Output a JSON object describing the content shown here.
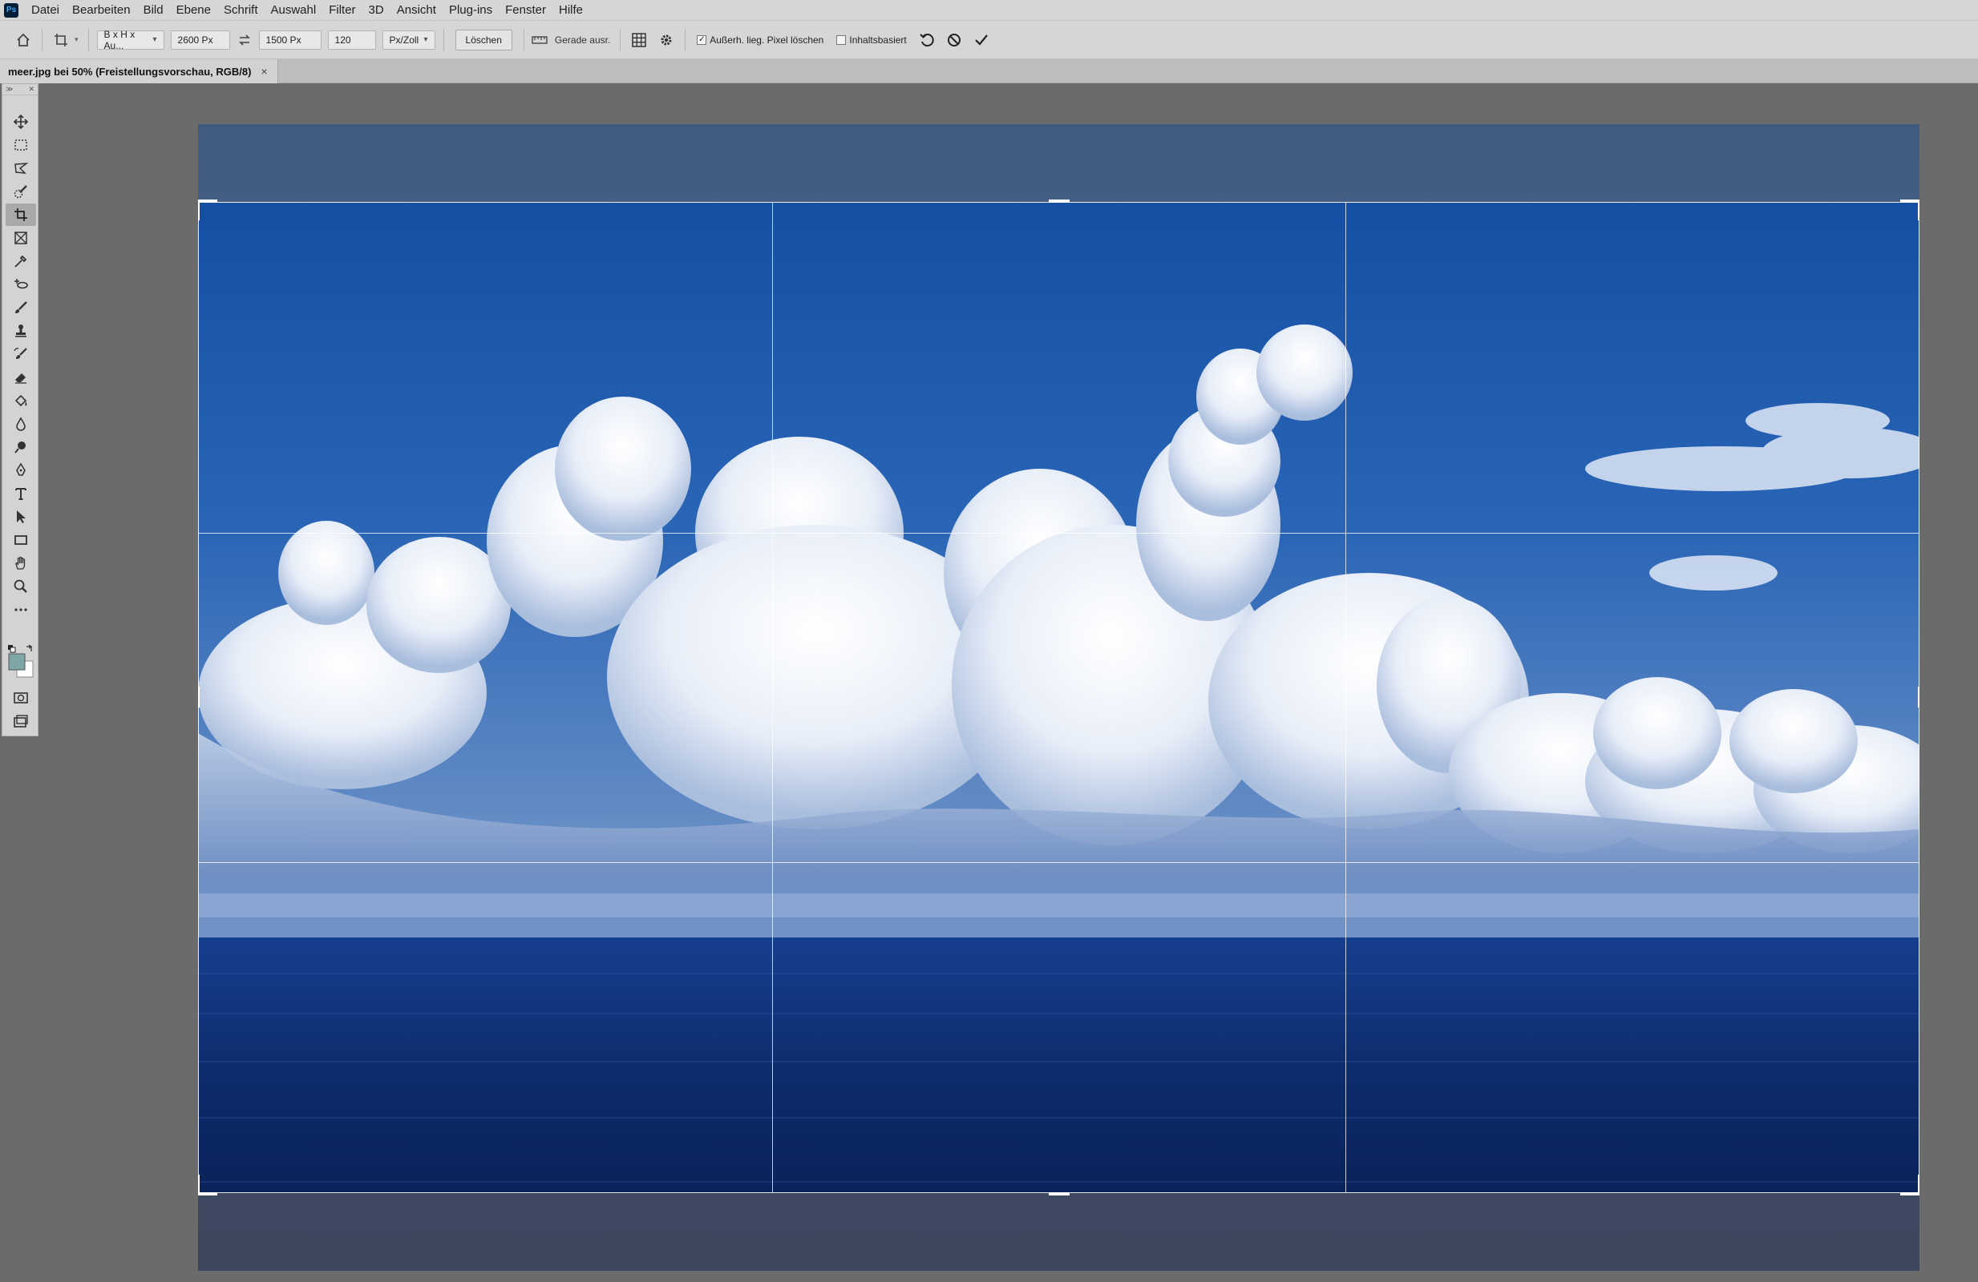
{
  "app": {
    "logo_text": "Ps"
  },
  "menu": [
    "Datei",
    "Bearbeiten",
    "Bild",
    "Ebene",
    "Schrift",
    "Auswahl",
    "Filter",
    "3D",
    "Ansicht",
    "Plug-ins",
    "Fenster",
    "Hilfe"
  ],
  "options": {
    "ratio_preset": "B x H x Au...",
    "width": "2600 Px",
    "height": "1500 Px",
    "resolution": "120",
    "resolution_unit": "Px/Zoll",
    "clear_button": "Löschen",
    "straighten": "Gerade ausr.",
    "delete_cropped_pixels": "Außerh. lieg. Pixel löschen",
    "delete_cropped_checked": true,
    "content_aware": "Inhaltsbasiert",
    "content_aware_checked": false
  },
  "document": {
    "tab_title": "meer.jpg bei 50% (Freistellungsvorschau, RGB/8)",
    "close_symbol": "×"
  },
  "icons": {
    "home": "home-icon",
    "crop_tool": "crop-tool-icon",
    "swap": "swap-dimensions-icon",
    "straighten": "straighten-icon",
    "overlay": "overlay-grid-icon",
    "settings": "gear-icon",
    "reset": "reset-icon",
    "cancel": "cancel-icon",
    "commit": "checkmark-icon"
  },
  "tools": [
    "move",
    "marquee",
    "lasso",
    "quick-selection",
    "crop",
    "frame",
    "eyedropper",
    "healing-brush",
    "brush",
    "clone-stamp",
    "history-brush",
    "eraser",
    "paint-bucket",
    "blur",
    "dodge",
    "pen",
    "type",
    "path-selection",
    "rectangle",
    "hand",
    "zoom",
    "more-tools",
    "quick-mask",
    "screen-mode"
  ],
  "colors": {
    "foreground": "#7fa6a6",
    "background": "#ffffff",
    "sky": "#1c56a8",
    "sea": "#0c2a6a"
  }
}
